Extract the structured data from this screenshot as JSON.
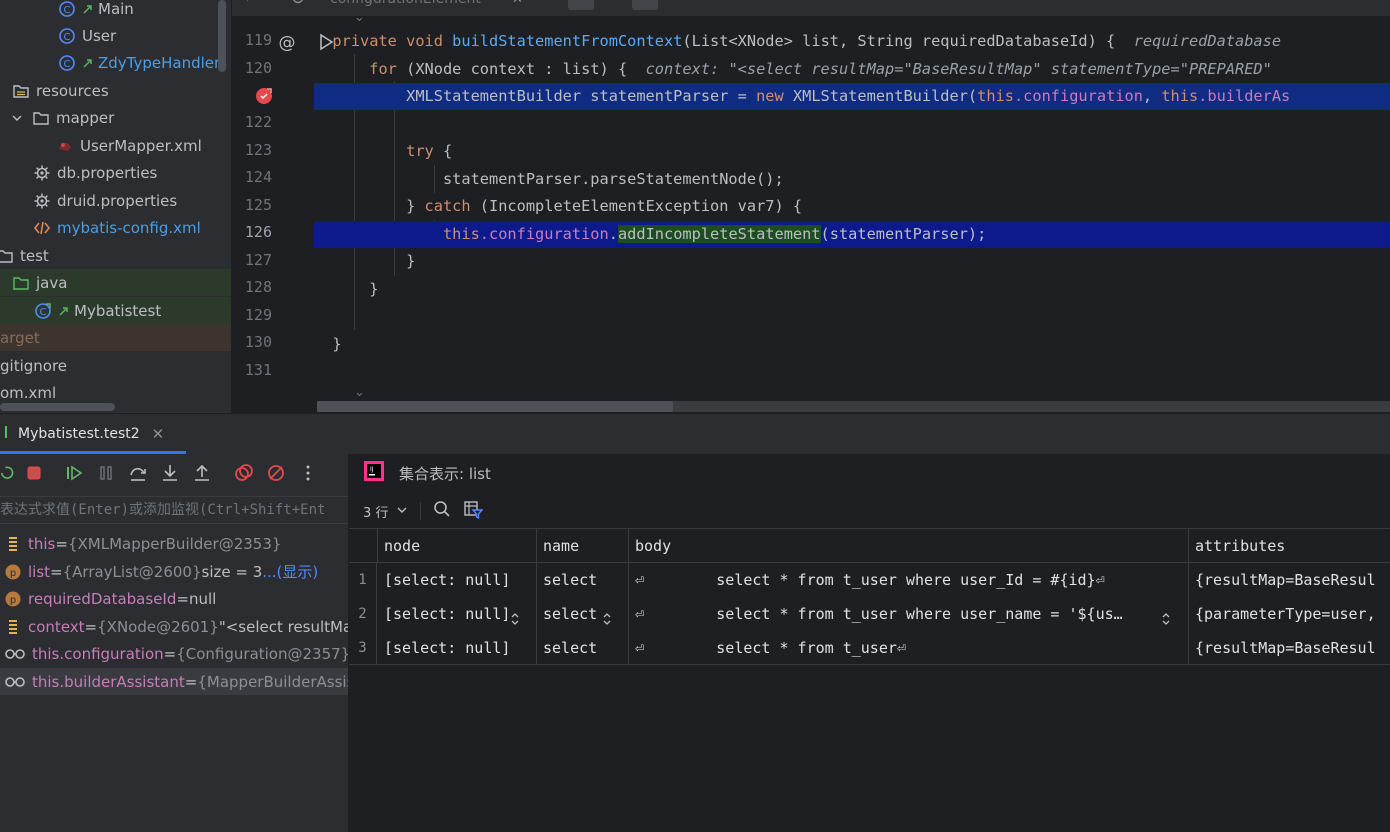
{
  "project_tree": {
    "items": [
      {
        "label": "Main",
        "kind": "class"
      },
      {
        "label": "User",
        "kind": "class"
      },
      {
        "label": "ZdyTypeHandler",
        "kind": "class"
      },
      {
        "label": "resources",
        "kind": "folder"
      },
      {
        "label": "mapper",
        "kind": "folder"
      },
      {
        "label": "UserMapper.xml",
        "kind": "xml"
      },
      {
        "label": "db.properties",
        "kind": "properties"
      },
      {
        "label": "druid.properties",
        "kind": "properties"
      },
      {
        "label": "mybatis-config.xml",
        "kind": "xml"
      },
      {
        "label": "test",
        "kind": "folder"
      },
      {
        "label": "java",
        "kind": "folder"
      },
      {
        "label": "Mybatistest",
        "kind": "class"
      },
      {
        "label": "arget",
        "kind": "folder"
      },
      {
        "label": "gitignore",
        "kind": "file"
      },
      {
        "label": "om.xml",
        "kind": "file"
      }
    ]
  },
  "editor": {
    "search_text": "configurationElement",
    "line_numbers": [
      "119",
      "120",
      "",
      "122",
      "123",
      "124",
      "125",
      "126",
      "127",
      "128",
      "129",
      "130",
      "131"
    ],
    "lines": {
      "l119": {
        "kw1": "private",
        "kw2": "void",
        "fn": "buildStatementFromContext",
        "params": "(List<XNode> list, String requiredDatabaseId) {",
        "hint": "requiredDatabase"
      },
      "l120": {
        "kw": "for",
        "code": "(XNode context : list) {",
        "hint": "context: \"<select resultMap=\"BaseResultMap\" statementType=\"PREPARED\""
      },
      "l121": {
        "code1": "XMLStatementBuilder statementParser = ",
        "kw": "new",
        "code2": " XMLStatementBuilder(",
        "this1": "this",
        "field1": ".configuration",
        "comma": ", ",
        "this2": "this",
        "field2": ".builderAs"
      },
      "l123": {
        "kw": "try",
        "code": " {"
      },
      "l124": {
        "code": "statementParser.parseStatementNode();"
      },
      "l125": {
        "code1": "} ",
        "kw": "catch",
        "code2": " (IncompleteElementException var7) {"
      },
      "l126": {
        "this": "this",
        "field": ".configuration",
        "dot": ".",
        "method": "addIncompleteStatement",
        "args": "(statementParser);"
      },
      "l127": {
        "code": "}"
      },
      "l128": {
        "code": "}"
      },
      "l130": {
        "code": "}"
      }
    }
  },
  "debug": {
    "tab_label": "Mybatistest.test2",
    "eval_placeholder": "表达式求值(Enter)或添加监视(Ctrl+Shift+Ent",
    "variables": [
      {
        "name": "this",
        "eq": " = ",
        "value": "{XMLMapperBuilder@2353}",
        "extra": "",
        "link": "",
        "kind": "field"
      },
      {
        "name": "list",
        "eq": " = ",
        "value": "{ArrayList@2600}",
        "extra": "  size = 3 ",
        "link": "...(显示)",
        "kind": "param"
      },
      {
        "name": "requiredDatabaseId",
        "eq": " = ",
        "value": "null",
        "extra": "",
        "link": "",
        "kind": "param"
      },
      {
        "name": "context",
        "eq": " = ",
        "value": "{XNode@2601}",
        "extra": " \"<select resultMa",
        "link": "",
        "kind": "field"
      },
      {
        "name": "this.configuration",
        "eq": " = ",
        "value": "{Configuration@2357}",
        "extra": "",
        "link": "",
        "kind": "watch"
      },
      {
        "name": "this.builderAssistant",
        "eq": " = ",
        "value": "{MapperBuilderAssist",
        "extra": "",
        "link": "",
        "kind": "watch"
      }
    ],
    "collection": {
      "title": "集合表示: list",
      "rows_label": "3 行",
      "columns": [
        "node",
        "name",
        "body",
        "attributes"
      ],
      "rows": [
        {
          "num": "1",
          "node": "[select: null]",
          "name": "select",
          "body": "⏎        select * from t_user where user_Id = #{id}⏎",
          "attributes": "{resultMap=BaseResul"
        },
        {
          "num": "2",
          "node": "[select: null]",
          "name": "select",
          "body": "⏎        select * from t_user where user_name = '${us…",
          "attributes": "{parameterType=user,"
        },
        {
          "num": "3",
          "node": "[select: null]",
          "name": "select",
          "body": "⏎        select * from t_user⏎",
          "attributes": "{resultMap=BaseResul"
        }
      ]
    }
  },
  "colors": {
    "keyword": "#cf8e6d",
    "method": "#57aaf7",
    "field": "#c77dbb",
    "line_highlight": "#102b82",
    "accent": "#3574f0"
  }
}
